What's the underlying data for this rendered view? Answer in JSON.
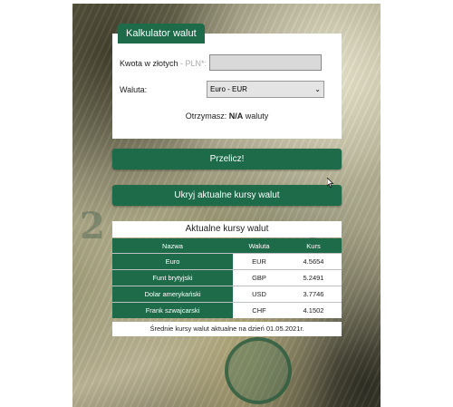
{
  "calculator": {
    "tab_title": "Kalkulator walut",
    "amount_label": "Kwota w złotych",
    "amount_label_hint": "- PLN*:",
    "amount_value": "",
    "currency_label": "Waluta:",
    "currency_selected": "Euro - EUR",
    "result_prefix": "Otrzymasz:",
    "result_value": "N/A",
    "result_suffix": "waluty"
  },
  "buttons": {
    "convert_label": "Przelicz!",
    "toggle_rates_label": "Ukryj aktualne kursy walut"
  },
  "rates": {
    "title": "Aktualne kursy walut",
    "columns": [
      "Nazwa",
      "Waluta",
      "Kurs"
    ],
    "rows": [
      {
        "name": "Euro",
        "code": "EUR",
        "rate": "4.5654"
      },
      {
        "name": "Funt brytyjski",
        "code": "GBP",
        "rate": "5.2491"
      },
      {
        "name": "Dolar amerykański",
        "code": "USD",
        "rate": "3.7746"
      },
      {
        "name": "Frank szwajcarski",
        "code": "CHF",
        "rate": "4.1502"
      }
    ],
    "footer": "Średnie kursy walut aktualne na dzień 01.05.2021r."
  },
  "colors": {
    "brand_green": "#1e6b4a"
  },
  "background": {
    "decor_numbers": [
      "2",
      "2"
    ]
  }
}
